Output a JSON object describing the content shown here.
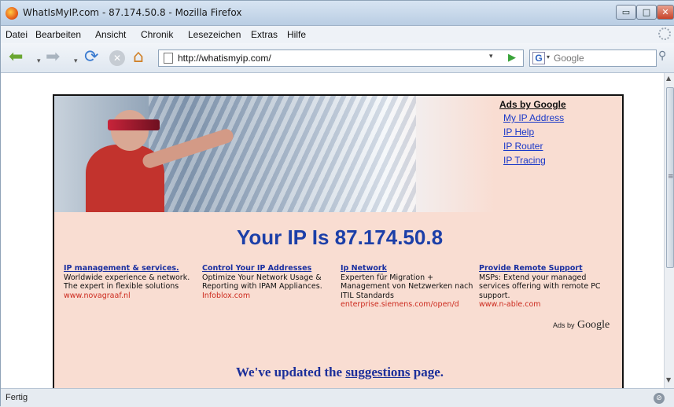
{
  "window": {
    "title": "WhatIsMyIP.com - 87.174.50.8 - Mozilla Firefox",
    "min_glyph": "▭",
    "max_glyph": "□",
    "close_glyph": "✕"
  },
  "menu": {
    "items": [
      {
        "label": "Datei"
      },
      {
        "label": "Bearbeiten"
      },
      {
        "label": "Ansicht"
      },
      {
        "label": "Chronik"
      },
      {
        "label": "Lesezeichen"
      },
      {
        "label": "Extras"
      },
      {
        "label": "Hilfe"
      }
    ]
  },
  "navbar": {
    "back_glyph": "⬅",
    "forward_glyph": "➡",
    "dropdown_glyph": "▾",
    "reload_glyph": "⟳",
    "stop_glyph": "✕",
    "home_glyph": "⌂",
    "url": "http://whatismyip.com/",
    "go_glyph": "▶",
    "search_engine_glyph": "G",
    "search_placeholder": "Google",
    "search_go_glyph": "⚲"
  },
  "icons": {
    "app": "firefox-icon",
    "page": "page-icon",
    "status": "security-icon"
  },
  "page": {
    "ads_title": "Ads by Google",
    "ads_links": [
      {
        "label": "My IP Address"
      },
      {
        "label": "IP Help"
      },
      {
        "label": "IP Router"
      },
      {
        "label": "IP Tracing"
      }
    ],
    "headline": "Your IP Is 87.174.50.8",
    "ad_columns": [
      {
        "title": "IP management & services.",
        "body": "Worldwide experience & network. The expert in flexible solutions",
        "url": "www.novagraaf.nl"
      },
      {
        "title": "Control Your IP Addresses",
        "body": "Optimize Your Network Usage & Reporting with IPAM Appliances.",
        "url": "Infoblox.com"
      },
      {
        "title": "Ip Network",
        "body": "Experten für Migration + Management von Netzwerken nach ITIL Standards",
        "url": "enterprise.siemens.com/open/d"
      },
      {
        "title": "Provide Remote Support",
        "body": "MSPs: Extend your managed services offering with remote PC support.",
        "url": "www.n-able.com"
      }
    ],
    "ads_footer_prefix": "Ads by",
    "ads_footer_brand": "Google",
    "updated_prefix": "We've updated the",
    "updated_link": "suggestions",
    "updated_suffix": "page."
  },
  "status": {
    "text": "Fertig",
    "icon_glyph": "⊘"
  },
  "colors": {
    "page_background": "#f9ddd2",
    "headline": "#1c3fa8",
    "link": "#1a38c8",
    "ad_url": "#cc2a1e"
  }
}
